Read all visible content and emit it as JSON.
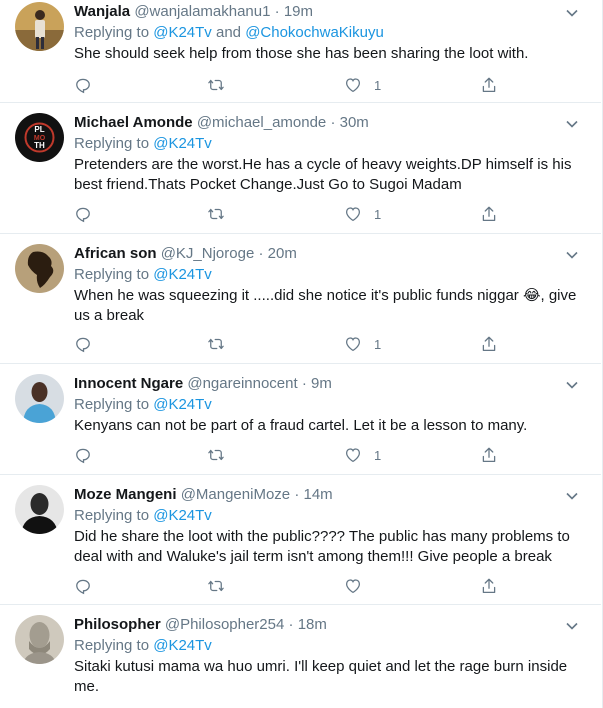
{
  "reply_prefix": "Replying to",
  "tweets": [
    {
      "name": "Wanjala",
      "handle": "@wanjalamakhanu1",
      "sep": "·",
      "time": "19m",
      "reply_to": "@K24Tv",
      "reply_and": "and",
      "reply_to2": "@ChokochwaKikuyu",
      "lines": [
        "She should seek help from those she has been sharing the loot with."
      ],
      "likes": "1",
      "avatar": "person-standing-avatar"
    },
    {
      "name": "Michael Amonde",
      "handle": "@michael_amonde",
      "sep": "·",
      "time": "30m",
      "reply_to": "@K24Tv",
      "lines": [
        "Pretenders are the worst.He has a cycle of heavy weights.DP himself is his",
        "best friend.Thats Pocket Change.Just Go to Sugoi Madam"
      ],
      "likes": "1",
      "avatar": "plenty-mouth-logo-avatar",
      "avatar_text": [
        "PL",
        "MO",
        "TH"
      ]
    },
    {
      "name": "African son",
      "handle": "@KJ_Njoroge",
      "sep": "·",
      "time": "20m",
      "reply_to": "@K24Tv",
      "lines": [
        "When he was squeezing it .....did she notice it's public funds niggar 😂, give",
        "us a break"
      ],
      "likes": "1",
      "avatar": "africa-map-avatar"
    },
    {
      "name": "Innocent Ngare",
      "handle": "@ngareinnocent",
      "sep": "·",
      "time": "9m",
      "reply_to": "@K24Tv",
      "lines": [
        "Kenyans can not be part of a fraud cartel. Let it be a lesson to many."
      ],
      "likes": "1",
      "avatar": "man-portrait-avatar"
    },
    {
      "name": "Moze Mangeni",
      "handle": "@MangeniMoze",
      "sep": "·",
      "time": "14m",
      "reply_to": "@K24Tv",
      "lines": [
        "Did he share the loot with the public???? The public has many problems to",
        "deal with and Waluke's jail term isn't among them!!! Give people a break"
      ],
      "likes": "",
      "avatar": "bw-man-portrait-avatar"
    },
    {
      "name": "Philosopher",
      "handle": "@Philosopher254",
      "sep": "·",
      "time": "18m",
      "reply_to": "@K24Tv",
      "lines": [
        "Sitaki kutusi mama wa huo umri. I'll keep quiet and let the rage burn inside",
        "me."
      ],
      "likes": "",
      "avatar": "statue-bust-avatar"
    }
  ]
}
